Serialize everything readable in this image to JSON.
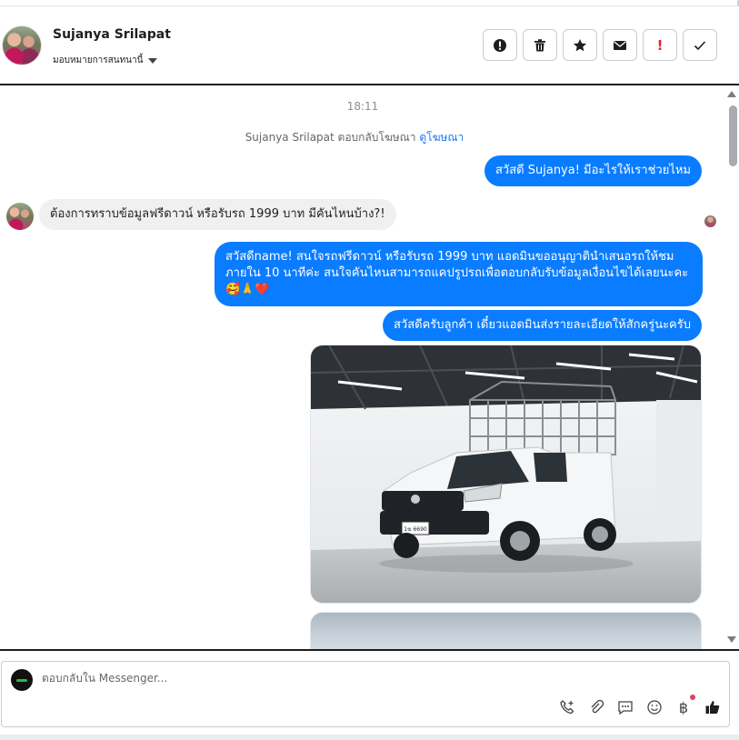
{
  "header": {
    "name": "Sujanya Srilapat",
    "assign_label": "มอบหมายการสนทนานี้"
  },
  "actions": [
    {
      "name": "spam-icon"
    },
    {
      "name": "trash-icon"
    },
    {
      "name": "star-icon"
    },
    {
      "name": "mail-icon"
    },
    {
      "name": "important-icon",
      "glyph": "!"
    },
    {
      "name": "check-icon"
    }
  ],
  "chat": {
    "time": "18:11",
    "system_prefix": "Sujanya Srilapat ตอบกลับโฆษณา",
    "system_link": "ดูโฆษณา",
    "messages": [
      {
        "side": "out",
        "text": "สวัสดี Sujanya! มีอะไรให้เราช่วยไหม"
      },
      {
        "side": "in",
        "text": "ต้องการทราบข้อมูลฟรีดาวน์ หรือรับรถ 1999 บาท มีคันไหนบ้าง?!"
      },
      {
        "side": "out",
        "text": "สวัสดีname! สนใจรถฟรีดาวน์ หรือรับรถ 1999 บาท แอดมินขออนุญาตินำเสนอรถให้ชม ภายใน 10 นาทีค่ะ สนใจคันไหนสามารถแคปรูปรถเพื่อตอบกลับรับข้อมูลเงื่อนไขได้เลยนะคะ🥰🙏❤️"
      },
      {
        "side": "out",
        "text": "สวัสดีครับลูกค้า เดี๋ยวแอดมินส่งรายละเอียดให้สักครู่นะครับ"
      }
    ],
    "car_plate": "1ฆ 6690"
  },
  "composer": {
    "placeholder": "ตอบกลับใน Messenger..."
  },
  "tools": [
    "call-add-icon",
    "attach-icon",
    "quick-reply-icon",
    "emoji-icon",
    "baht-icon",
    "like-icon"
  ],
  "baht_glyph": "฿",
  "colors": {
    "accent": "#0a7cff",
    "incoming": "#f0f0f0",
    "important": "#e4262c"
  }
}
